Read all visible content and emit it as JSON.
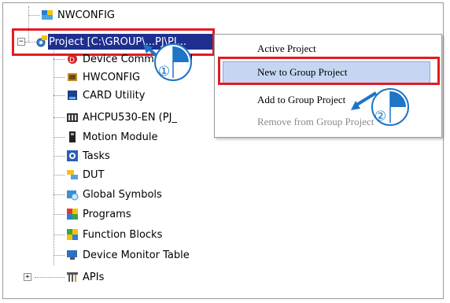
{
  "tree": {
    "root": {
      "label": "NWCONFIG",
      "icon": "nwconfig-icon"
    },
    "project": {
      "label": "Project [C:\\GROUP\\...PJ\\PJ...",
      "icon": "project-gear-icon",
      "expander": "−"
    },
    "children": [
      {
        "label": "Device Comment & U",
        "icon": "device-comment-icon"
      },
      {
        "label": "HWCONFIG",
        "icon": "hwconfig-icon"
      },
      {
        "label": "CARD Utility",
        "icon": "card-utility-icon"
      },
      {
        "label": "AHCPU530-EN  (PJ_",
        "icon": "ahcpu-icon"
      },
      {
        "label": "Motion Module",
        "icon": "motion-module-icon"
      },
      {
        "label": "Tasks",
        "icon": "tasks-icon"
      },
      {
        "label": "DUT",
        "icon": "dut-icon"
      },
      {
        "label": "Global Symbols",
        "icon": "global-symbols-icon"
      },
      {
        "label": "Programs",
        "icon": "programs-icon"
      },
      {
        "label": "Function Blocks",
        "icon": "function-blocks-icon"
      },
      {
        "label": "Device Monitor Table",
        "icon": "device-monitor-icon"
      },
      {
        "label": "APIs",
        "icon": "apis-icon",
        "expander": "+"
      }
    ]
  },
  "context_menu": {
    "items": [
      {
        "label": "Active Project",
        "enabled": true
      },
      {
        "label": "New to Group Project",
        "enabled": true,
        "highlighted": true
      },
      {
        "label": "Add to Group Project",
        "enabled": true
      },
      {
        "label": "Remove from Group Project",
        "enabled": false
      }
    ]
  },
  "callouts": [
    {
      "number": "①",
      "icon": "mouse-click-icon"
    },
    {
      "number": "②",
      "icon": "mouse-click-icon"
    }
  ],
  "colors": {
    "selection": "#1f2f8f",
    "highlight_box": "#e31b23",
    "menu_highlight": "#c6d6f2",
    "callout": "#1e74c6",
    "disabled_text": "#8a8a8a"
  }
}
